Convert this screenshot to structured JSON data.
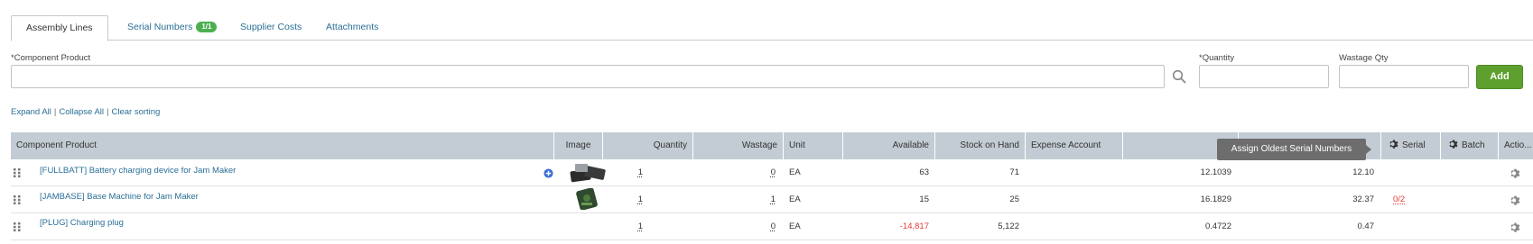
{
  "tabs": [
    {
      "label": "Assembly Lines"
    },
    {
      "label": "Serial Numbers",
      "badge": "1/1"
    },
    {
      "label": "Supplier Costs"
    },
    {
      "label": "Attachments"
    }
  ],
  "form": {
    "component_label": "Component Product",
    "component_required": "*",
    "quantity_label": "Quantity",
    "quantity_required": "*",
    "wastage_label": "Wastage Qty",
    "add_label": "Add"
  },
  "links": {
    "expand": "Expand All",
    "collapse": "Collapse All",
    "clear": "Clear sorting",
    "separator": "|"
  },
  "columns": {
    "component": "Component Product",
    "image": "Image",
    "quantity": "Quantity",
    "wastage": "Wastage",
    "unit": "Unit",
    "available": "Available",
    "stock": "Stock on Hand",
    "expense": "Expense Account",
    "unit_cost": "Un",
    "serial": "Serial",
    "batch": "Batch",
    "actions": "Actio..."
  },
  "tooltip": "Assign Oldest Serial Numbers",
  "rows": [
    {
      "product": "[FULLBATT] Battery charging device for Jam Maker",
      "quantity": "1",
      "wastage": "0",
      "unit": "EA",
      "available": "63",
      "stock": "71",
      "unit_cost": "12.1039",
      "total": "12.10",
      "serial": ""
    },
    {
      "product": "[JAMBASE] Base Machine for Jam Maker",
      "quantity": "1",
      "wastage": "1",
      "unit": "EA",
      "available": "15",
      "stock": "25",
      "unit_cost": "16.1829",
      "total": "32.37",
      "serial": "0/2"
    },
    {
      "product": "[PLUG] Charging plug",
      "quantity": "1",
      "wastage": "0",
      "unit": "EA",
      "available": "-14,817",
      "stock": "5,122",
      "unit_cost": "0.4722",
      "total": "0.47",
      "serial": ""
    }
  ],
  "colors": {
    "accent": "#2a6f97",
    "add_button": "#5da02e",
    "header_bg": "#c3ccd4",
    "negative": "#e53935",
    "badge": "#4caf50"
  }
}
